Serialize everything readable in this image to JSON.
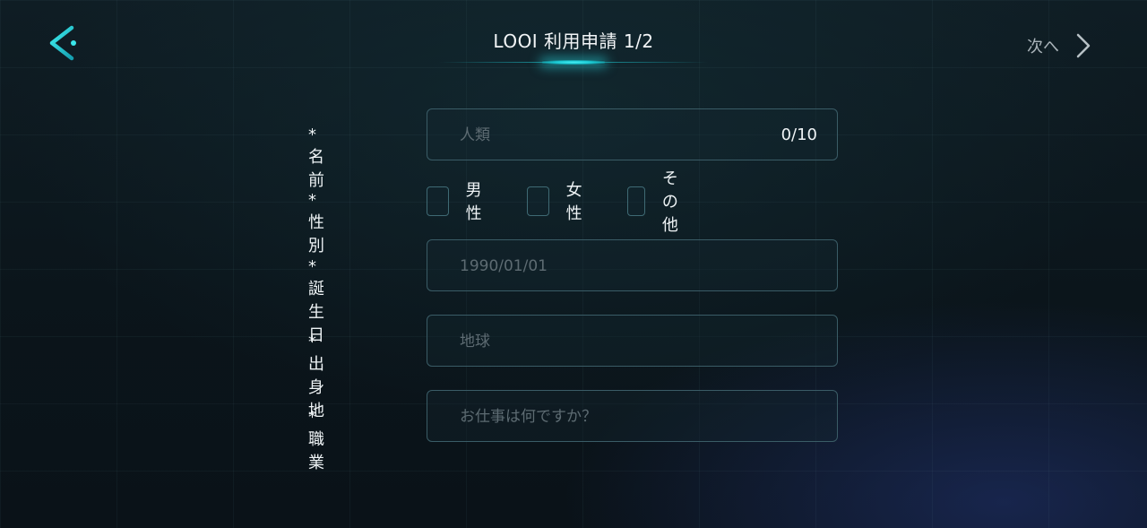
{
  "header": {
    "back_icon": "chevron-left-arrow-icon",
    "title": "LOOI 利用申請 1/2",
    "next_label": "次へ",
    "next_icon": "chevron-right-icon"
  },
  "colors": {
    "accent": "#1ec8d2",
    "field_border": "#3a5c66",
    "background": "#0c171d"
  },
  "form": {
    "name": {
      "label": "* 名前",
      "placeholder": "人類",
      "counter": "0/10"
    },
    "gender": {
      "label": "* 性別",
      "options": [
        "男性",
        "女性",
        "その他"
      ]
    },
    "birthday": {
      "label": "* 誕生日",
      "placeholder": "1990/01/01"
    },
    "birthplace": {
      "label": "* 出身地",
      "placeholder": "地球"
    },
    "occupation": {
      "label": "* 職業",
      "placeholder": "お仕事は何ですか？"
    }
  }
}
